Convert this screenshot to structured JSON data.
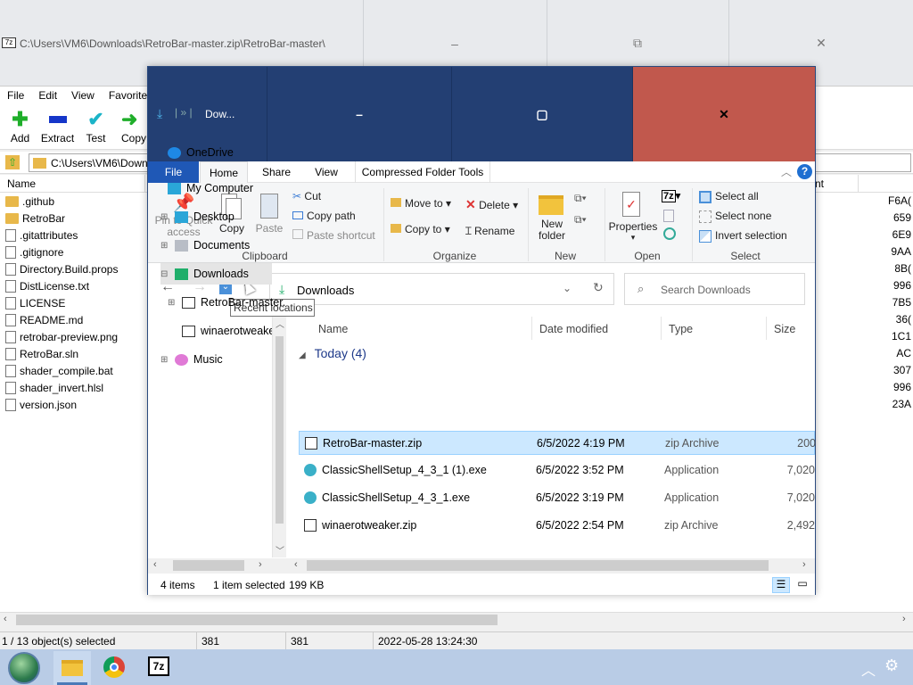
{
  "sevenzip": {
    "title": "C:\\Users\\VM6\\Downloads\\RetroBar-master.zip\\RetroBar-master\\",
    "caption_min": "–",
    "caption_max": "⧉",
    "caption_close": "✕",
    "menu": [
      "File",
      "Edit",
      "View",
      "Favorites"
    ],
    "toolbar": {
      "add": "Add",
      "extract": "Extract",
      "test": "Test",
      "copy": "Copy"
    },
    "address": "C:\\Users\\VM6\\Downloads\\RetroBar-master.zip\\RetroBar-master\\",
    "list_header": {
      "name": "Name",
      "right_hdr": "nt"
    },
    "files": [
      {
        "name": ".github",
        "type": "folder",
        "right": "F6A("
      },
      {
        "name": "RetroBar",
        "type": "folder",
        "right": "659"
      },
      {
        "name": ".gitattributes",
        "type": "file",
        "right": "6E9"
      },
      {
        "name": ".gitignore",
        "type": "file",
        "right": "9AA"
      },
      {
        "name": "Directory.Build.props",
        "type": "file",
        "right": "8B("
      },
      {
        "name": "DistLicense.txt",
        "type": "file",
        "right": "996"
      },
      {
        "name": "LICENSE",
        "type": "file",
        "right": "7B5"
      },
      {
        "name": "README.md",
        "type": "file",
        "right": "36("
      },
      {
        "name": "retrobar-preview.png",
        "type": "file",
        "right": "1C1"
      },
      {
        "name": "RetroBar.sln",
        "type": "file",
        "right": "AC"
      },
      {
        "name": "shader_compile.bat",
        "type": "file",
        "right": "307"
      },
      {
        "name": "shader_invert.hlsl",
        "type": "file",
        "right": "996"
      },
      {
        "name": "version.json",
        "type": "file",
        "right": "23A"
      }
    ],
    "status": {
      "selection": "1 / 13 object(s) selected",
      "size1": "381",
      "size2": "381",
      "date": "2022-05-28 13:24:30"
    }
  },
  "explorer": {
    "title_path": "Dow...",
    "caption_min": "–",
    "caption_max": "▢",
    "caption_close": "✕",
    "tabs": {
      "file": "File",
      "home": "Home",
      "share": "Share",
      "view": "View",
      "compressed": "Compressed Folder Tools"
    },
    "ribbon": {
      "pin": "Pin to Quick access",
      "copy": "Copy",
      "paste": "Paste",
      "cut": "Cut",
      "copy_path": "Copy path",
      "paste_shortcut": "Paste shortcut",
      "clipboard": "Clipboard",
      "move_to": "Move to",
      "copy_to": "Copy to",
      "delete": "Delete",
      "rename": "Rename",
      "organize": "Organize",
      "new_folder": "New folder",
      "new": "New",
      "properties": "Properties",
      "open": "Open",
      "select_all": "Select all",
      "select_none": "Select none",
      "invert_selection": "Invert selection",
      "select": "Select"
    },
    "address": "Downloads",
    "search_placeholder": "Search Downloads",
    "tooltip": "Recent locations",
    "tree": [
      {
        "label": "OneDrive",
        "indent": 0,
        "icon": "cloud-icon",
        "expander": ""
      },
      {
        "label": "My Computer",
        "indent": 0,
        "icon": "computer-icon",
        "expander": ""
      },
      {
        "label": "Desktop",
        "indent": 1,
        "icon": "desktop-icon",
        "expander": "⊞"
      },
      {
        "label": "Documents",
        "indent": 1,
        "icon": "documents-icon",
        "expander": "⊞"
      },
      {
        "label": "Downloads",
        "indent": 1,
        "icon": "downloads-icon",
        "expander": "⊟"
      },
      {
        "label": "RetroBar-master.",
        "indent": 2,
        "icon": "zip-icon",
        "expander": "⊞"
      },
      {
        "label": "winaerotweaker.z",
        "indent": 2,
        "icon": "zip-icon",
        "expander": ""
      },
      {
        "label": "Music",
        "indent": 1,
        "icon": "music-icon",
        "expander": "⊞"
      }
    ],
    "columns": {
      "name": "Name",
      "date": "Date modified",
      "type": "Type",
      "size": "Size"
    },
    "group": "Today (4)",
    "files": [
      {
        "name": "RetroBar-master.zip",
        "date": "6/5/2022 4:19 PM",
        "type": "zip Archive",
        "size": "200",
        "selected": true
      },
      {
        "name": "ClassicShellSetup_4_3_1 (1).exe",
        "date": "6/5/2022 3:52 PM",
        "type": "Application",
        "size": "7,020",
        "selected": false
      },
      {
        "name": "ClassicShellSetup_4_3_1.exe",
        "date": "6/5/2022 3:19 PM",
        "type": "Application",
        "size": "7,020",
        "selected": false
      },
      {
        "name": "winaerotweaker.zip",
        "date": "6/5/2022 2:54 PM",
        "type": "zip Archive",
        "size": "2,492",
        "selected": false
      }
    ],
    "status": {
      "items": "4 items",
      "selected": "1 item selected",
      "size": "199 KB"
    }
  },
  "taskbar": {
    "sevenzip_label": "7z"
  }
}
